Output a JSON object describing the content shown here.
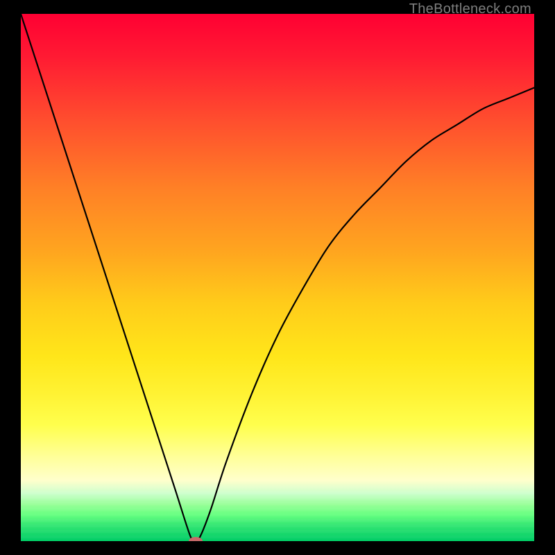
{
  "watermark": "TheBottleneck.com",
  "chart_data": {
    "type": "line",
    "title": "",
    "xlabel": "",
    "ylabel": "",
    "xlim": [
      0,
      100
    ],
    "ylim": [
      0,
      100
    ],
    "series": [
      {
        "name": "bottleneck-curve",
        "x": [
          0,
          5,
          10,
          15,
          20,
          25,
          30,
          33,
          34,
          35,
          37,
          40,
          45,
          50,
          55,
          60,
          65,
          70,
          75,
          80,
          85,
          90,
          95,
          100
        ],
        "values": [
          100,
          85,
          70,
          55,
          40,
          25,
          10,
          1,
          0,
          1,
          6,
          15,
          28,
          39,
          48,
          56,
          62,
          67,
          72,
          76,
          79,
          82,
          84,
          86
        ]
      }
    ],
    "marker": {
      "x": 34,
      "y": 0,
      "color": "#c96a6a"
    },
    "gradient_stops": [
      {
        "pos": 0,
        "color": "#ff0033"
      },
      {
        "pos": 0.5,
        "color": "#ffcc1a"
      },
      {
        "pos": 0.8,
        "color": "#ffff66"
      },
      {
        "pos": 1.0,
        "color": "#00cc66"
      }
    ],
    "grid": false,
    "legend": false
  }
}
